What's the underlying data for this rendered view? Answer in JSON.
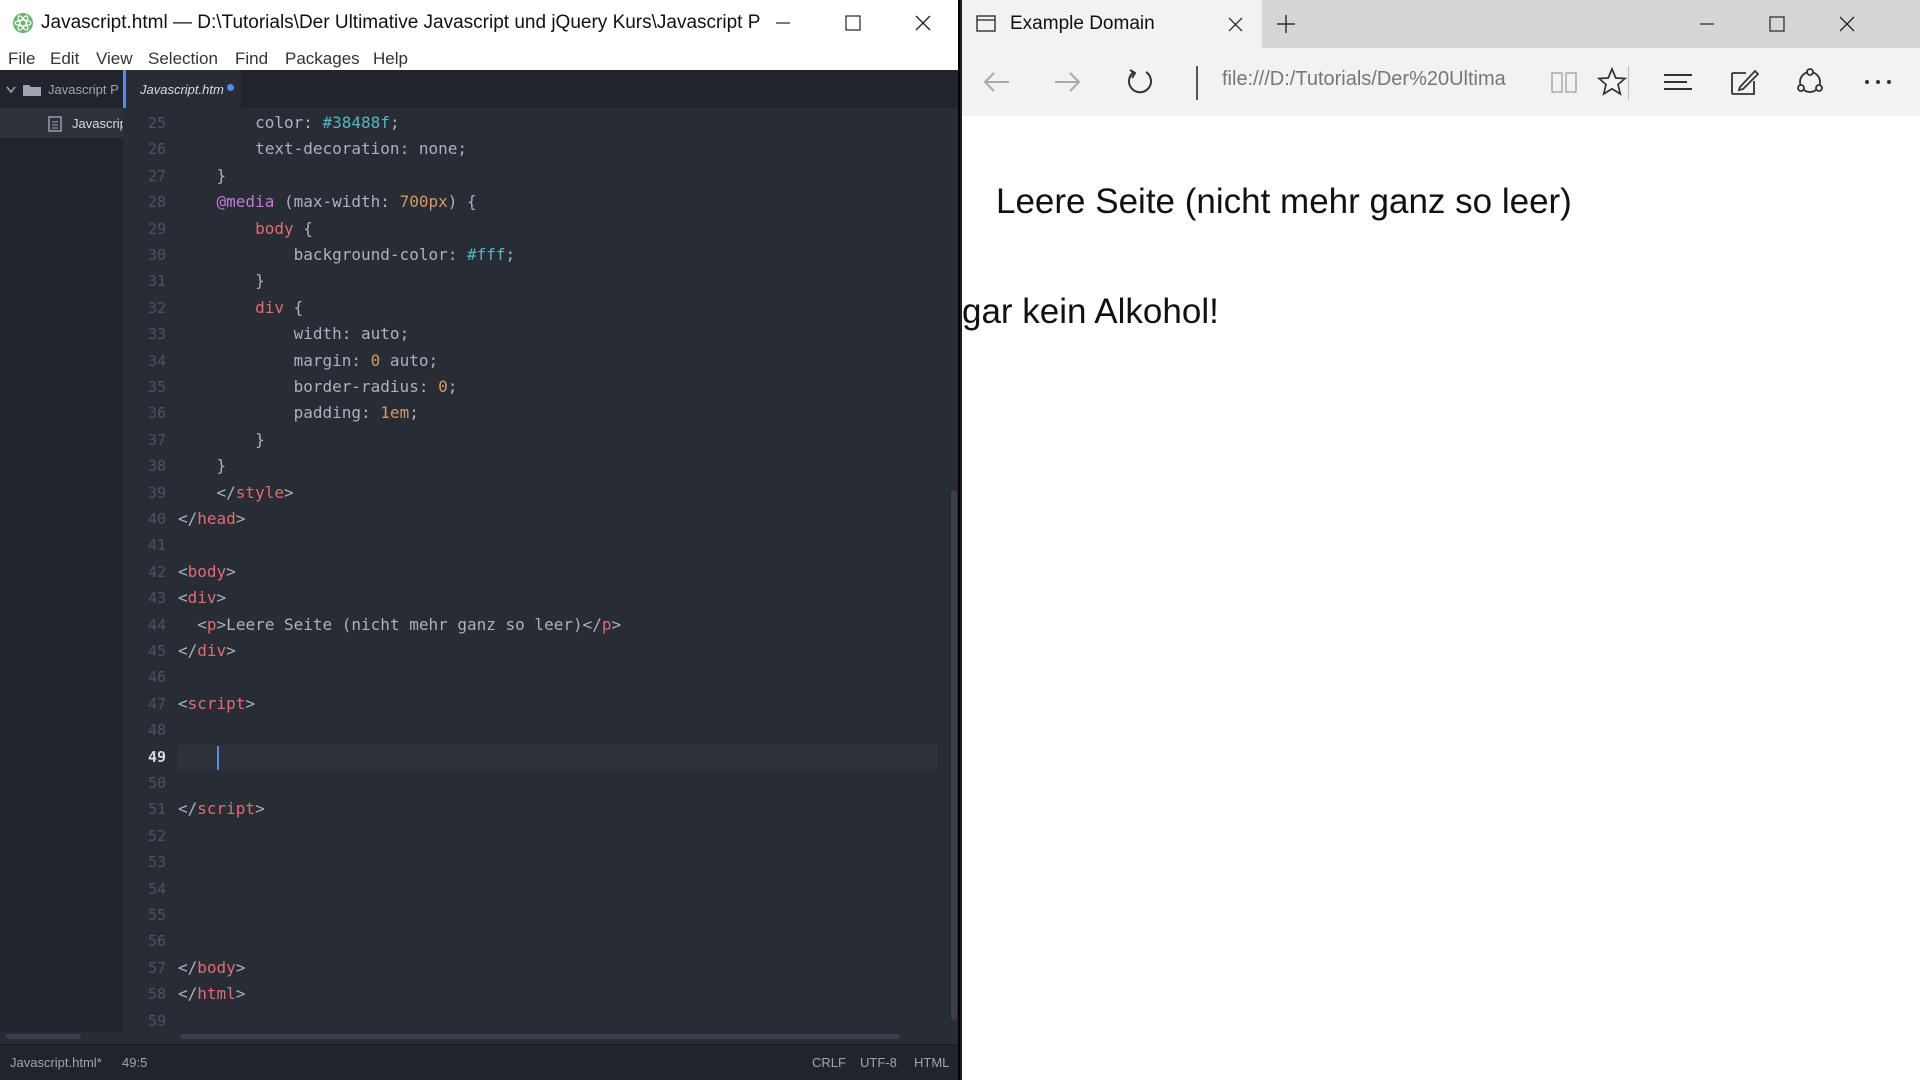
{
  "atom": {
    "title": "Javascript.html — D:\\Tutorials\\Der Ultimative Javascript und jQuery Kurs\\Javascript Proj...",
    "menu": [
      "File",
      "Edit",
      "View",
      "Selection",
      "Find",
      "Packages",
      "Help"
    ],
    "tree": {
      "project": "Javascript P",
      "file": "Javascrip"
    },
    "tab": {
      "label": "Javascript.htm"
    },
    "lines": [
      {
        "n": "25",
        "html": "        <span class='t-prop'>color</span>: <span class='t-str'>#38488f</span>;"
      },
      {
        "n": "26",
        "html": "        <span class='t-prop'>text-decoration</span>: none;"
      },
      {
        "n": "27",
        "html": "    }"
      },
      {
        "n": "28",
        "html": "    <span class='t-at'>@media</span> (max-width: <span class='t-num'>700px</span>) {"
      },
      {
        "n": "29",
        "html": "        <span class='t-tag'>body</span> {"
      },
      {
        "n": "30",
        "html": "            <span class='t-prop'>background-color</span>: <span class='t-str'>#fff</span>;"
      },
      {
        "n": "31",
        "html": "        }"
      },
      {
        "n": "32",
        "html": "        <span class='t-tag'>div</span> {"
      },
      {
        "n": "33",
        "html": "            <span class='t-prop'>width</span>: auto;"
      },
      {
        "n": "34",
        "html": "            <span class='t-prop'>margin</span>: <span class='t-num'>0</span> auto;"
      },
      {
        "n": "35",
        "html": "            <span class='t-prop'>border-radius</span>: <span class='t-num'>0</span>;"
      },
      {
        "n": "36",
        "html": "            <span class='t-prop'>padding</span>: <span class='t-num'>1em</span>;"
      },
      {
        "n": "37",
        "html": "        }"
      },
      {
        "n": "38",
        "html": "    }"
      },
      {
        "n": "39",
        "html": "    &lt;/<span class='t-tag'>style</span>&gt;"
      },
      {
        "n": "40",
        "html": "&lt;/<span class='t-tag'>head</span>&gt;"
      },
      {
        "n": "41",
        "html": ""
      },
      {
        "n": "42",
        "html": "&lt;<span class='t-tag'>body</span>&gt;"
      },
      {
        "n": "43",
        "html": "&lt;<span class='t-tag'>div</span>&gt;"
      },
      {
        "n": "44",
        "html": "  &lt;<span class='t-tag'>p</span>&gt;Leere Seite (nicht mehr ganz so leer)&lt;/<span class='t-tag'>p</span>&gt;"
      },
      {
        "n": "45",
        "html": "&lt;/<span class='t-tag'>div</span>&gt;"
      },
      {
        "n": "46",
        "html": ""
      },
      {
        "n": "47",
        "html": "&lt;<span class='t-tag'>script</span>&gt;"
      },
      {
        "n": "48",
        "html": ""
      },
      {
        "n": "49",
        "html": ""
      },
      {
        "n": "50",
        "html": ""
      },
      {
        "n": "51",
        "html": "&lt;/<span class='t-tag'>script</span>&gt;"
      },
      {
        "n": "52",
        "html": ""
      },
      {
        "n": "53",
        "html": ""
      },
      {
        "n": "54",
        "html": ""
      },
      {
        "n": "55",
        "html": ""
      },
      {
        "n": "56",
        "html": ""
      },
      {
        "n": "57",
        "html": "&lt;/<span class='t-tag'>body</span>&gt;"
      },
      {
        "n": "58",
        "html": "&lt;/<span class='t-tag'>html</span>&gt;"
      },
      {
        "n": "59",
        "html": ""
      }
    ],
    "active_line": "49",
    "status": {
      "file": "Javascript.html*",
      "cursor": "49:5",
      "line_ending": "CRLF",
      "encoding": "UTF-8",
      "grammar": "HTML"
    }
  },
  "edge": {
    "tab_title": "Example Domain",
    "address": "file:///D:/Tutorials/Der%20Ultima",
    "page": {
      "heading": "Leere Seite (nicht mehr ganz so leer)",
      "text": "gar kein Alkohol!"
    }
  }
}
